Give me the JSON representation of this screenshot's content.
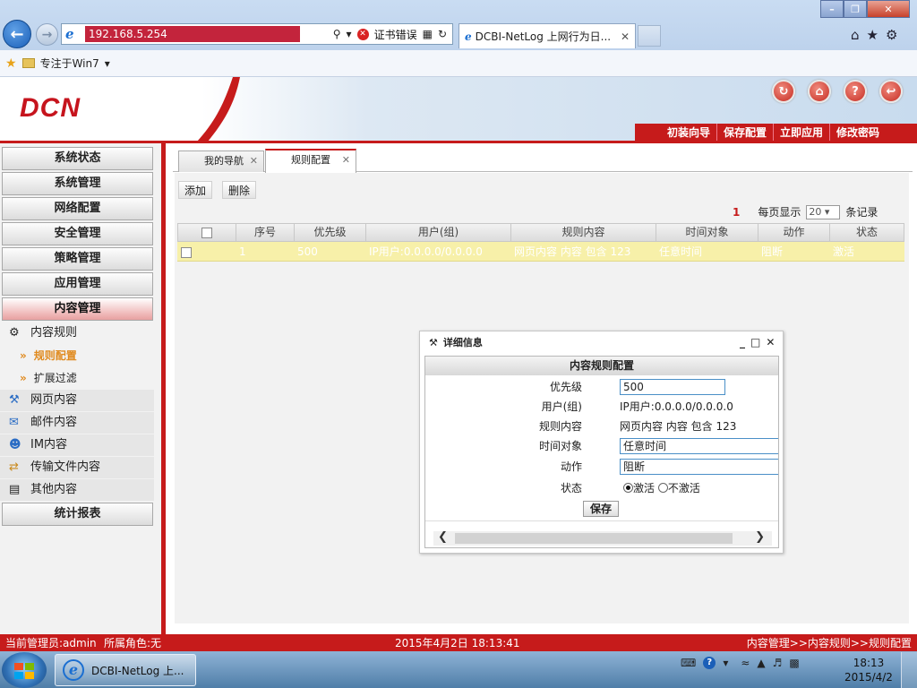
{
  "browser": {
    "address_url": "192.168.5.254",
    "cert_error": "证书错误",
    "tab_title": "DCBI-NetLog 上网行为日...",
    "tab_close": "✕",
    "favorites_label": "专注于Win7",
    "win_min": "–",
    "win_max": "❐",
    "win_close": "✕"
  },
  "header": {
    "logo": "DCN",
    "icons": [
      "refresh-icon",
      "home-icon",
      "help-icon",
      "logout-icon"
    ],
    "quick_links": [
      "初装向导",
      "保存配置",
      "立即应用",
      "修改密码"
    ],
    "brand_color": "#c61b1b"
  },
  "sidebar": {
    "menus_top": [
      "系统状态",
      "系统管理",
      "网络配置",
      "安全管理",
      "策略管理",
      "应用管理",
      "内容管理"
    ],
    "active_menu": "内容管理",
    "sub_content_rules": "内容规则",
    "leaf_rule_config": "规则配置",
    "leaf_ext_filter": "扩展过滤",
    "subs": [
      "网页内容",
      "邮件内容",
      "IM内容",
      "传输文件内容",
      "其他内容"
    ],
    "menu_report": "统计报表"
  },
  "page_tabs": {
    "tab1": "我的导航",
    "tab2": "规则配置",
    "close": "✕"
  },
  "toolbar": {
    "add": "添加",
    "delete": "删除"
  },
  "pager": {
    "count": "1",
    "per_page_label": "每页显示",
    "per_page_value": "20",
    "records_label": "条记录"
  },
  "table": {
    "columns": [
      "序号",
      "优先级",
      "用户(组)",
      "规则内容",
      "时间对象",
      "动作",
      "状态"
    ],
    "rows": [
      [
        "1",
        "500",
        "IP用户:0.0.0.0/0.0.0.0",
        "网页内容 内容 包含 123",
        "任意时间",
        "阻断",
        "激活"
      ]
    ]
  },
  "dialog": {
    "title": "详细信息",
    "section": "内容规则配置",
    "priority_label": "优先级",
    "priority_value": "500",
    "user_label": "用户(组)",
    "user_value": "IP用户:0.0.0.0/0.0.0.0",
    "rule_label": "规则内容",
    "rule_value": "网页内容 内容 包含 123",
    "time_label": "时间对象",
    "time_value": "任意时间",
    "action_label": "动作",
    "action_value": "阻断",
    "status_label": "状态",
    "status_active": "激活",
    "status_inactive": "不激活",
    "save": "保存",
    "ctl_min": "_",
    "ctl_max": "□",
    "ctl_close": "✕"
  },
  "statusbar": {
    "admin": "当前管理员:admin",
    "role": "所属角色:无",
    "datetime": "2015年4月2日 18:13:41",
    "breadcrumb": "内容管理>>内容规则>>规则配置"
  },
  "taskbar": {
    "item": "DCBI-NetLog 上...",
    "time": "18:13",
    "date": "2015/4/2"
  }
}
